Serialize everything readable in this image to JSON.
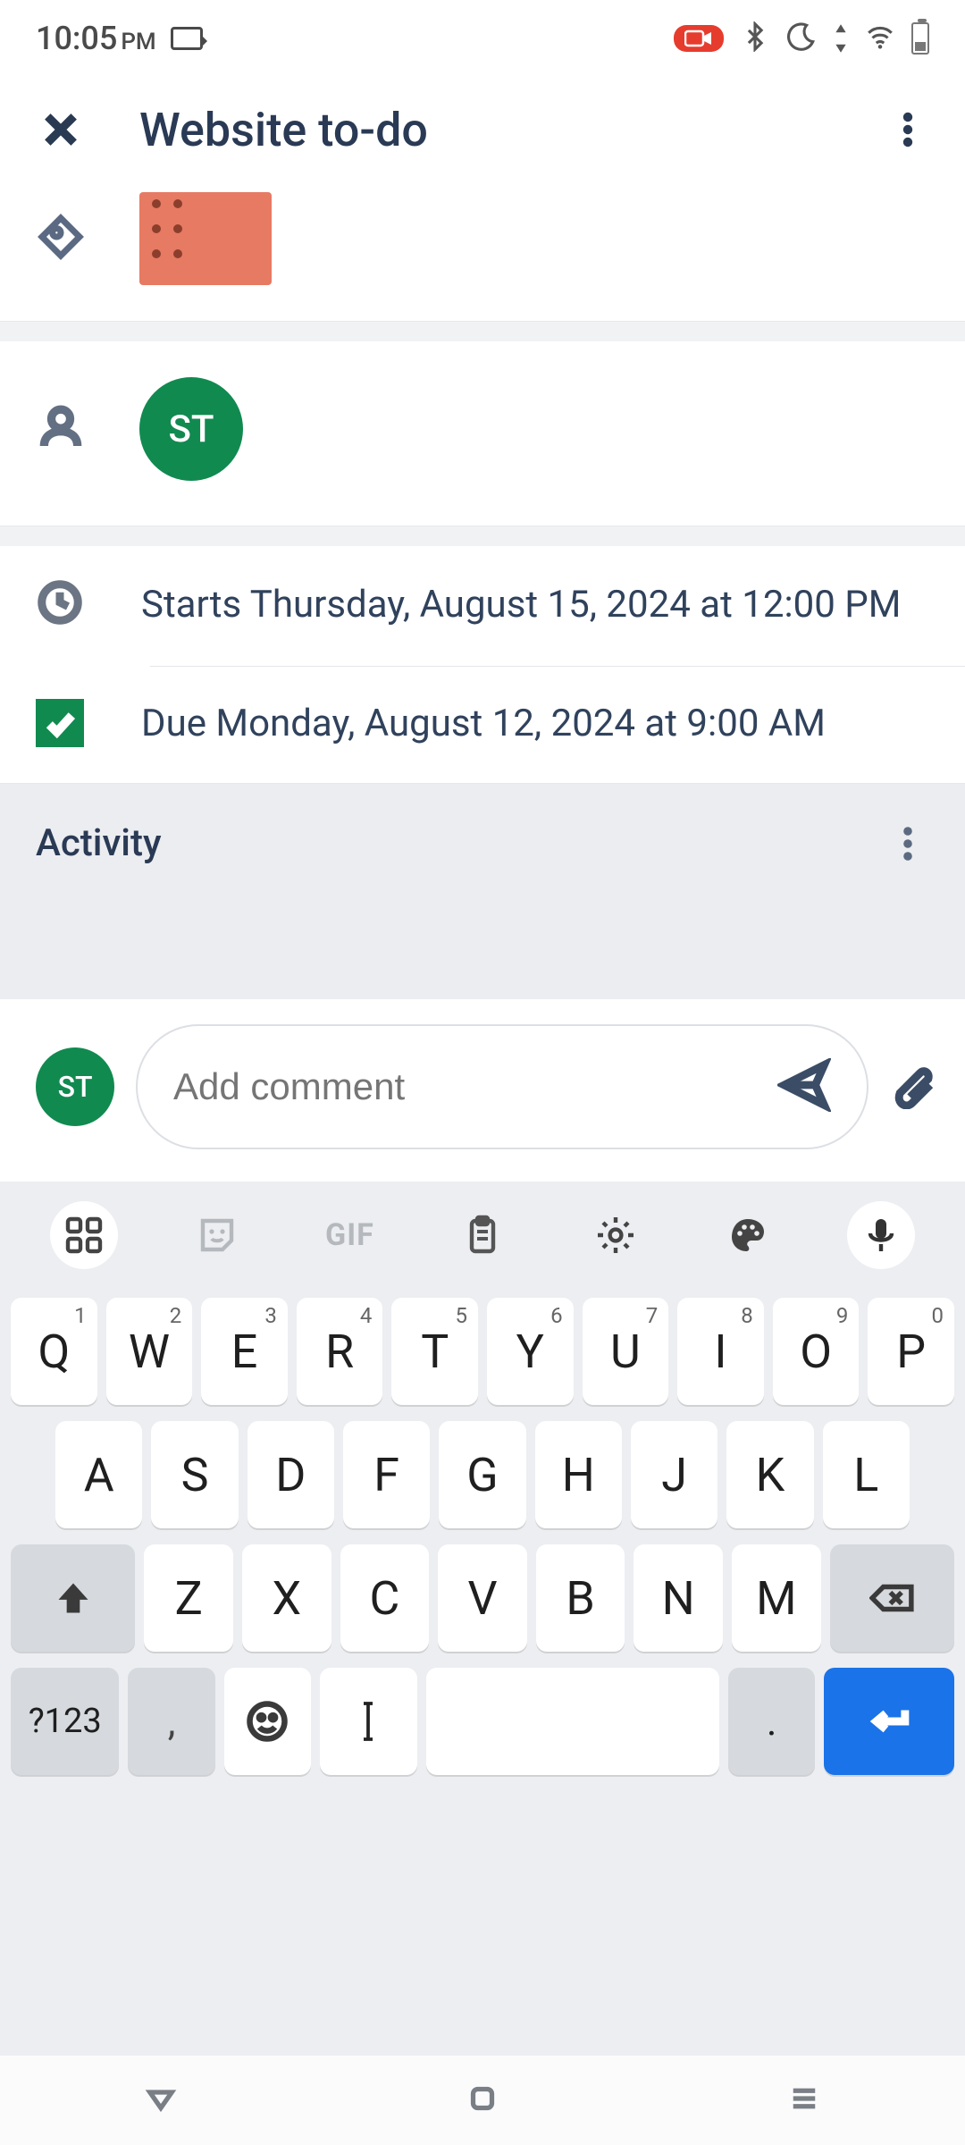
{
  "status": {
    "time": "10:05",
    "ampm": "PM"
  },
  "header": {
    "title": "Website to-do"
  },
  "assignee": {
    "initials": "ST"
  },
  "dates": {
    "start": "Starts Thursday, August 15, 2024 at 12:00 PM",
    "due": "Due Monday, August 12, 2024 at 9:00 AM"
  },
  "activity": {
    "label": "Activity"
  },
  "comment": {
    "avatar_initials": "ST",
    "placeholder": "Add comment"
  },
  "keyboard": {
    "gif": "GIF",
    "row1": [
      {
        "k": "Q",
        "s": "1"
      },
      {
        "k": "W",
        "s": "2"
      },
      {
        "k": "E",
        "s": "3"
      },
      {
        "k": "R",
        "s": "4"
      },
      {
        "k": "T",
        "s": "5"
      },
      {
        "k": "Y",
        "s": "6"
      },
      {
        "k": "U",
        "s": "7"
      },
      {
        "k": "I",
        "s": "8"
      },
      {
        "k": "O",
        "s": "9"
      },
      {
        "k": "P",
        "s": "0"
      }
    ],
    "row2": [
      "A",
      "S",
      "D",
      "F",
      "G",
      "H",
      "J",
      "K",
      "L"
    ],
    "row3": [
      "Z",
      "X",
      "C",
      "V",
      "B",
      "N",
      "M"
    ],
    "sym": "?123",
    "comma": ",",
    "period": "."
  }
}
